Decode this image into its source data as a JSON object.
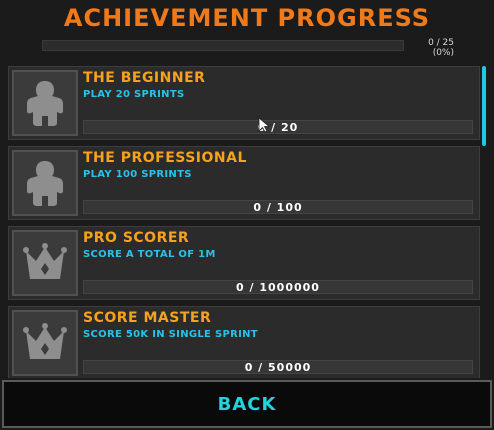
{
  "screen": {
    "title": "ACHIEVEMENT PROGRESS",
    "overall_progress_text": "0 / 25 (0%)",
    "overall_progress_fraction": 0
  },
  "colors": {
    "title": "#f07a1a",
    "achievement_title": "#f5a21e",
    "achievement_desc": "#27c3ea",
    "accent": "#22c7e6",
    "back_text": "#22d3d9"
  },
  "achievements": [
    {
      "title": "THE BEGINNER",
      "desc": "PLAY 20 SPRINTS",
      "progress_text": "0 / 20",
      "progress_fraction": 0,
      "icon": "player-figure-icon"
    },
    {
      "title": "THE PROFESSIONAL",
      "desc": "PLAY 100 SPRINTS",
      "progress_text": "0 / 100",
      "progress_fraction": 0,
      "icon": "player-figure-icon"
    },
    {
      "title": "PRO SCORER",
      "desc": "SCORE A TOTAL OF 1M",
      "progress_text": "0 / 1000000",
      "progress_fraction": 0,
      "icon": "crown-icon"
    },
    {
      "title": "SCORE MASTER",
      "desc": "SCORE 50K IN SINGLE SPRINT",
      "progress_text": "0 / 50000",
      "progress_fraction": 0,
      "icon": "crown-icon"
    }
  ],
  "footer": {
    "back_label": "BACK"
  }
}
